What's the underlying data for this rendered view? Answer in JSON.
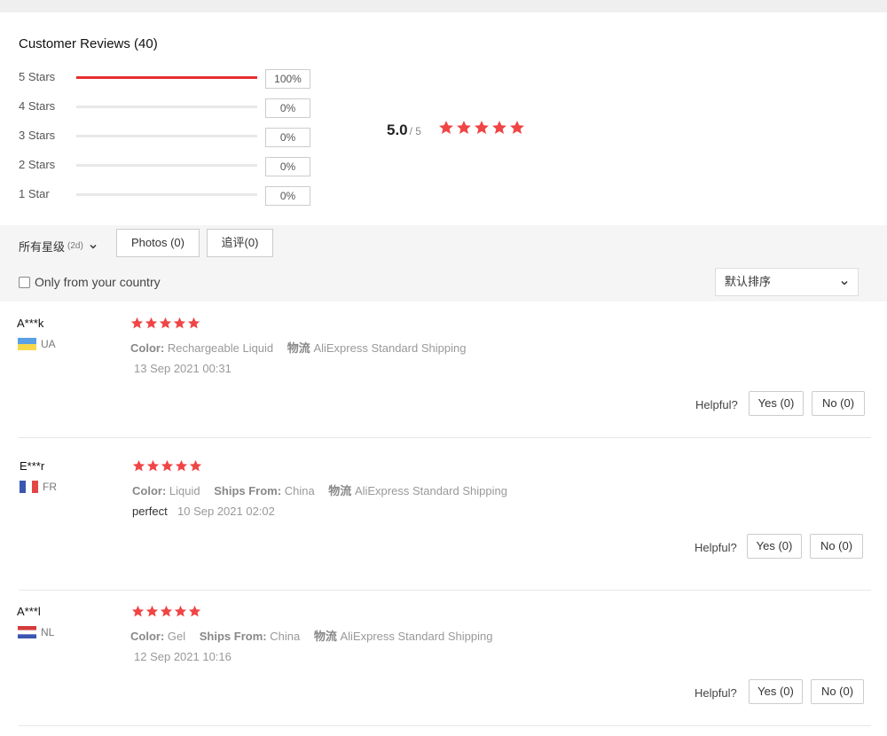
{
  "reviews_header": {
    "title": "Customer Reviews (40)"
  },
  "distribution": [
    {
      "label": "5 Stars",
      "percent": "100%",
      "fill": 1.0
    },
    {
      "label": "4 Stars",
      "percent": "0%",
      "fill": 0
    },
    {
      "label": "3 Stars",
      "percent": "0%",
      "fill": 0
    },
    {
      "label": "2 Stars",
      "percent": "0%",
      "fill": 0
    },
    {
      "label": "1 Star",
      "percent": "0%",
      "fill": 0
    }
  ],
  "average": {
    "score": "5.0",
    "out_of": "/ 5",
    "stars": 5
  },
  "filters": {
    "all_stars_label": "所有星级",
    "all_stars_count": "(2d)",
    "photos_label": "Photos (0)",
    "additional_label": "追评(0)",
    "country_only_label": "Only from your country",
    "sort_value": "默认排序"
  },
  "colors": {
    "accent": "#e62e2e",
    "star": "#f04545"
  },
  "reviews": [
    {
      "name": "A***k",
      "country": "UA",
      "stars": 5,
      "color_label": "Color:",
      "color_value": "Rechargeable Liquid",
      "ships_label": "",
      "ships_value": "",
      "logistics_label": "物流",
      "logistics_value": "AliExpress Standard Shipping",
      "text": "",
      "date": "13 Sep 2021 00:31",
      "helpful_label": "Helpful?",
      "yes_label": "Yes (0)",
      "no_label": "No (0)"
    },
    {
      "name": "E***r",
      "country": "FR",
      "stars": 5,
      "color_label": "Color:",
      "color_value": "Liquid",
      "ships_label": "Ships From:",
      "ships_value": "China",
      "logistics_label": "物流",
      "logistics_value": "AliExpress Standard Shipping",
      "text": "perfect",
      "date": "10 Sep 2021 02:02",
      "helpful_label": "Helpful?",
      "yes_label": "Yes (0)",
      "no_label": "No (0)"
    },
    {
      "name": "A***l",
      "country": "NL",
      "stars": 5,
      "color_label": "Color:",
      "color_value": "Gel",
      "ships_label": "Ships From:",
      "ships_value": "China",
      "logistics_label": "物流",
      "logistics_value": "AliExpress Standard Shipping",
      "text": "",
      "date": "12 Sep 2021 10:16",
      "helpful_label": "Helpful?",
      "yes_label": "Yes (0)",
      "no_label": "No (0)"
    }
  ]
}
